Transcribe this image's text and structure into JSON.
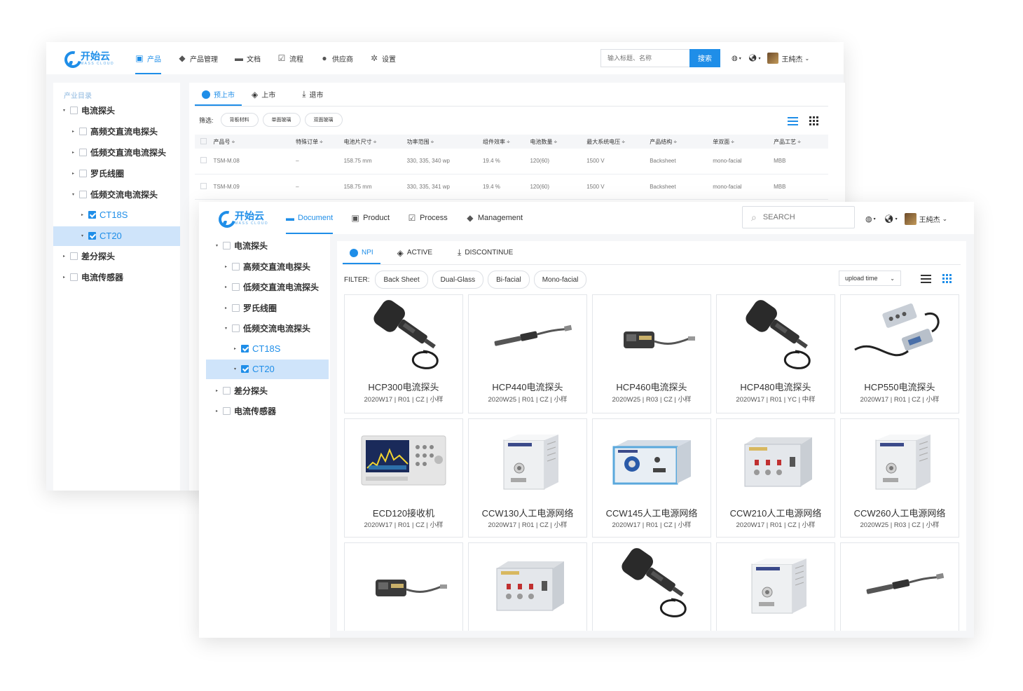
{
  "back": {
    "logo": {
      "cn": "开始云",
      "en": "MASS CLOUD"
    },
    "nav": [
      {
        "label": "产品",
        "icon": "bag-icon",
        "active": true
      },
      {
        "label": "产品管理",
        "icon": "cube-icon",
        "active": false
      },
      {
        "label": "文档",
        "icon": "folder-icon",
        "active": false
      },
      {
        "label": "流程",
        "icon": "checklist-icon",
        "active": false
      },
      {
        "label": "供应商",
        "icon": "user-icon",
        "active": false
      },
      {
        "label": "设置",
        "icon": "gear-icon",
        "active": false
      }
    ],
    "search": {
      "placeholder": "输入标题、名称",
      "button": "搜索"
    },
    "user": "王純杰",
    "sidebar": {
      "title": "产业目录",
      "items": [
        {
          "label": "电流探头",
          "arrow": "▾",
          "checked": false
        },
        {
          "label": "高频交直流电探头",
          "arrow": "▸",
          "checked": false
        },
        {
          "label": "低频交直流电流探头",
          "arrow": "▸",
          "checked": false
        },
        {
          "label": "罗氏线圈",
          "arrow": "▸",
          "checked": false
        },
        {
          "label": "低频交流电流探头",
          "arrow": "▾",
          "checked": false
        },
        {
          "label": "CT18S",
          "arrow": "▸",
          "checked": true
        },
        {
          "label": "CT20",
          "arrow": "▾",
          "checked": true
        },
        {
          "label": "差分探头",
          "arrow": "▸",
          "checked": false
        },
        {
          "label": "电流传感器",
          "arrow": "▸",
          "checked": false
        }
      ]
    },
    "tabs": [
      {
        "label": "预上市",
        "icon": "clock-icon",
        "active": true
      },
      {
        "label": "上市",
        "icon": "tag-icon",
        "active": false
      },
      {
        "label": "退市",
        "icon": "download-icon",
        "active": false
      }
    ],
    "filter": {
      "label": "筛选:",
      "chips": [
        "背板材料",
        "单面玻璃",
        "双面玻璃"
      ]
    },
    "table": {
      "headers": [
        "产品号 ÷",
        "特殊订单 ÷",
        "电池片尺寸 ÷",
        "功率范围 ÷",
        "组件效率 ÷",
        "电池数量 ÷",
        "最大系统电压 ÷",
        "产品结构 ÷",
        "单双面 ÷",
        "产品工艺 ÷"
      ],
      "rows": [
        [
          "TSM-M.08",
          "–",
          "158.75 mm",
          "330, 335, 340 wp",
          "19.4 %",
          "120(60)",
          "1500 V",
          "Backsheet",
          "mono-facial",
          "MBB"
        ],
        [
          "TSM-M.09",
          "–",
          "158.75 mm",
          "330, 335, 341 wp",
          "19.4 %",
          "120(60)",
          "1500 V",
          "Backsheet",
          "mono-facial",
          "MBB"
        ]
      ]
    }
  },
  "front": {
    "logo": {
      "cn": "开始云",
      "en": "MASS CLOUD"
    },
    "nav": [
      {
        "label": "Document",
        "icon": "folder-icon",
        "active": true
      },
      {
        "label": "Product",
        "icon": "bag-icon",
        "active": false
      },
      {
        "label": "Process",
        "icon": "checklist-icon",
        "active": false
      },
      {
        "label": "Management",
        "icon": "cube-icon",
        "active": false
      }
    ],
    "search": {
      "placeholder": "SEARCH"
    },
    "user": "王純杰",
    "sidebar": {
      "items": [
        {
          "label": "电流探头",
          "arrow": "▾",
          "checked": false
        },
        {
          "label": "高频交直流电探头",
          "arrow": "▸",
          "checked": false
        },
        {
          "label": "低频交直流电流探头",
          "arrow": "▸",
          "checked": false
        },
        {
          "label": "罗氏线圈",
          "arrow": "▸",
          "checked": false
        },
        {
          "label": "低频交流电流探头",
          "arrow": "▾",
          "checked": false
        },
        {
          "label": "CT18S",
          "arrow": "▸",
          "checked": true
        },
        {
          "label": "CT20",
          "arrow": "▾",
          "checked": true
        },
        {
          "label": "差分探头",
          "arrow": "▸",
          "checked": false
        },
        {
          "label": "电流传感器",
          "arrow": "▸",
          "checked": false
        }
      ]
    },
    "tabs": [
      {
        "label": "NPI",
        "icon": "clock-icon",
        "active": true
      },
      {
        "label": "ACTIVE",
        "icon": "tag-icon",
        "active": false
      },
      {
        "label": "DISCONTINUE",
        "icon": "download-icon",
        "active": false
      }
    ],
    "filter": {
      "label": "FILTER:",
      "chips": [
        "Back Sheet",
        "Dual-Glass",
        "Bi-facial",
        "Mono-facial"
      ]
    },
    "sort": {
      "value": "upload time"
    },
    "cards": [
      {
        "name": "HCP300电流探头",
        "meta": "2020W17 | R01 | CZ | 小样",
        "kind": "clamp"
      },
      {
        "name": "HCP440电流探头",
        "meta": "2020W25 | R01 | CZ | 小样",
        "kind": "stick"
      },
      {
        "name": "HCP460电流探头",
        "meta": "2020W25 | R03 | CZ | 小样",
        "kind": "small-clamp"
      },
      {
        "name": "HCP480电流探头",
        "meta": "2020W17 | R01 | YC | 中样",
        "kind": "clamp"
      },
      {
        "name": "HCP550电流探头",
        "meta": "2020W17 | R01 | CZ | 小样",
        "kind": "box-probe"
      },
      {
        "name": "ECD120接收机",
        "meta": "2020W17 | R01 | CZ | 小样",
        "kind": "receiver"
      },
      {
        "name": "CCW130人工电源网络",
        "meta": "2020W17 | R01 | CZ | 小样",
        "kind": "lisn"
      },
      {
        "name": "CCW145人工电源网络",
        "meta": "2020W17 | R01 | CZ | 小样",
        "kind": "lisn-blue"
      },
      {
        "name": "CCW210人工电源网络",
        "meta": "2020W17 | R01 | CZ | 小样",
        "kind": "lisn-red"
      },
      {
        "name": "CCW260人工电源网络",
        "meta": "2020W25 | R03 | CZ | 小样",
        "kind": "lisn"
      },
      {
        "name": "",
        "meta": "",
        "kind": "small-clamp"
      },
      {
        "name": "",
        "meta": "",
        "kind": "lisn-red"
      },
      {
        "name": "",
        "meta": "",
        "kind": "clamp"
      },
      {
        "name": "",
        "meta": "",
        "kind": "lisn"
      },
      {
        "name": "",
        "meta": "",
        "kind": "stick"
      }
    ]
  },
  "colors": {
    "accent": "#1f8ee8",
    "highlight": "#cfe4fa"
  }
}
